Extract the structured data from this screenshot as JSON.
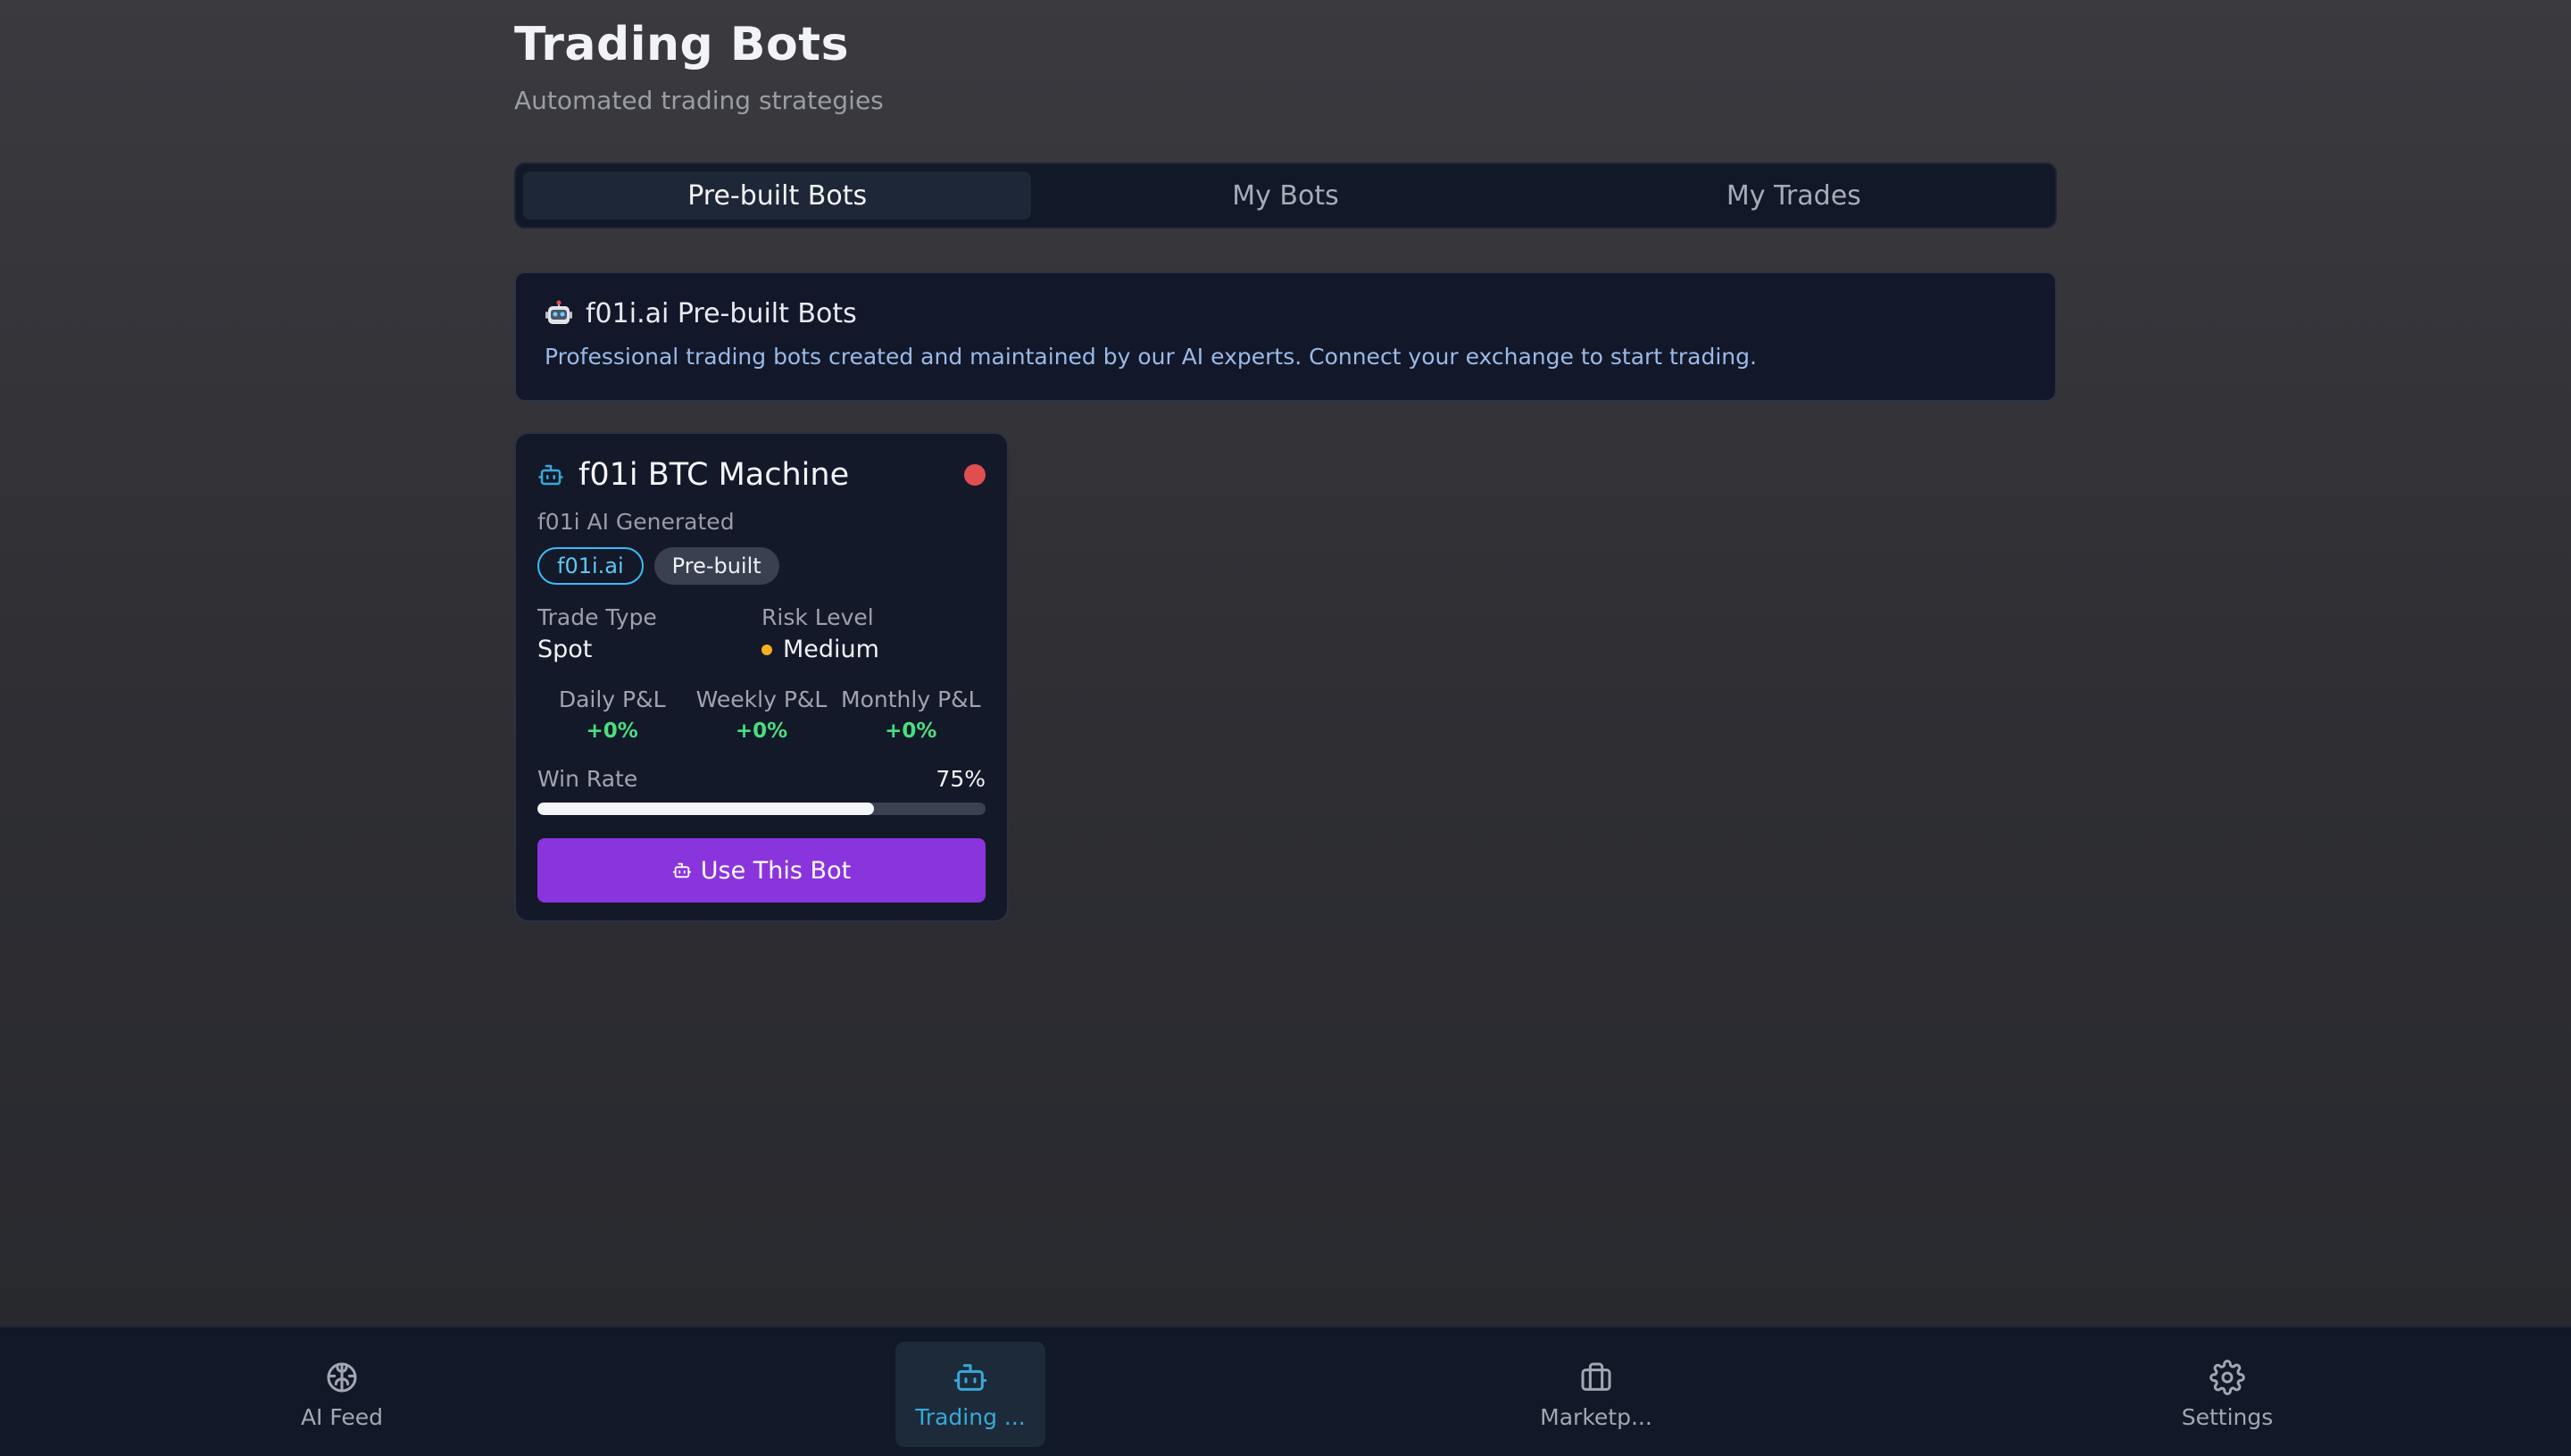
{
  "page": {
    "title": "Trading Bots",
    "subtitle": "Automated trading strategies"
  },
  "tabs": [
    {
      "label": "Pre-built Bots",
      "active": true
    },
    {
      "label": "My Bots",
      "active": false
    },
    {
      "label": "My Trades",
      "active": false
    }
  ],
  "info": {
    "icon": "robot-emoji-icon",
    "title": "f01i.ai Pre-built Bots",
    "description": "Professional trading bots created and maintained by our AI experts. Connect your exchange to start trading."
  },
  "bot_card": {
    "icon": "bot-icon",
    "name": "f01i BTC Machine",
    "status_color": "#e04f4f",
    "subtitle": "f01i AI Generated",
    "badges": [
      "f01i.ai",
      "Pre-built"
    ],
    "trade_type_label": "Trade Type",
    "trade_type_value": "Spot",
    "risk_label": "Risk Level",
    "risk_value": "Medium",
    "risk_color": "#f5b021",
    "pnl": [
      {
        "label": "Daily P&L",
        "value": "+0%"
      },
      {
        "label": "Weekly P&L",
        "value": "+0%"
      },
      {
        "label": "Monthly P&L",
        "value": "+0%"
      }
    ],
    "win_rate_label": "Win Rate",
    "win_rate_value": "75%",
    "win_rate_fraction": 0.75,
    "button_label": "Use This Bot",
    "accent": "#8a34dd"
  },
  "bottom_nav": [
    {
      "label": "AI Feed",
      "icon": "brain-icon",
      "active": false
    },
    {
      "label": "Trading ...",
      "icon": "bot-icon",
      "active": true
    },
    {
      "label": "Marketp...",
      "icon": "briefcase-icon",
      "active": false
    },
    {
      "label": "Settings",
      "icon": "gear-icon",
      "active": false
    }
  ]
}
